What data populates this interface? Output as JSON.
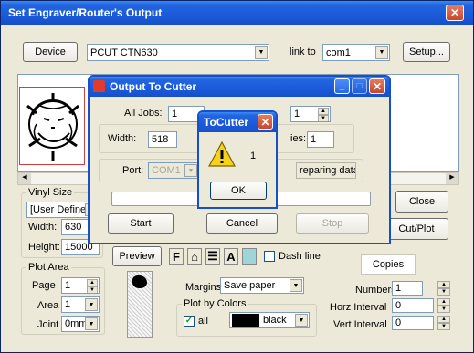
{
  "main_window": {
    "title": "Set Engraver/Router's Output",
    "device_button": "Device",
    "device_value": "PCUT CTN630",
    "link_to_label": "link to",
    "link_value": "com1",
    "setup_button": "Setup...",
    "vinyl_size_group": "Vinyl Size",
    "vinyl_size_value": "[User Define",
    "width_label": "Width:",
    "width_value": "630",
    "height_label": "Height:",
    "height_value": "15000",
    "plot_area_group": "Plot Area",
    "page_label": "Page",
    "page_value": "1",
    "area_label": "Area",
    "area_value": "1",
    "joint_label": "Joint",
    "joint_value": "0mm",
    "preview_button": "Preview",
    "toolbar_f": "F",
    "toolbar_a": "A",
    "dash_line_label": "Dash line",
    "margins_label": "Margins",
    "margins_value": "Save paper",
    "plot_by_colors_group": "Plot by Colors",
    "all_label": "all",
    "color_value": "black",
    "copies_label": "Copies",
    "numbers_label": "Numbers",
    "numbers_value": "1",
    "horz_interval_label": "Horz Interval",
    "horz_interval_value": "0",
    "vert_interval_label": "Vert Interval",
    "vert_interval_value": "0",
    "close_button": "Close",
    "cutplot_button": "Cut/Plot"
  },
  "output_dialog": {
    "title": "Output To Cutter",
    "all_jobs_label": "All Jobs:",
    "all_jobs_value": "1",
    "current_value": "1",
    "width_label": "Width:",
    "width_value": "518",
    "copies_label_fragment": "ies:",
    "copies_value": "1",
    "port_label": "Port:",
    "port_value": "COM1",
    "status_text": "reparing data",
    "start_button": "Start",
    "cancel_button": "Cancel",
    "stop_button": "Stop"
  },
  "message_box": {
    "title": "ToCutter",
    "message": "1",
    "ok_button": "OK"
  },
  "colors": {
    "title_bar": "#1b5ad8",
    "panel": "#ece9d8",
    "close_button": "#c9462c"
  },
  "icons": [
    "close-icon",
    "minimize-icon",
    "maximize-icon",
    "warning-icon",
    "app-icon",
    "checkbox-checked-icon"
  ]
}
